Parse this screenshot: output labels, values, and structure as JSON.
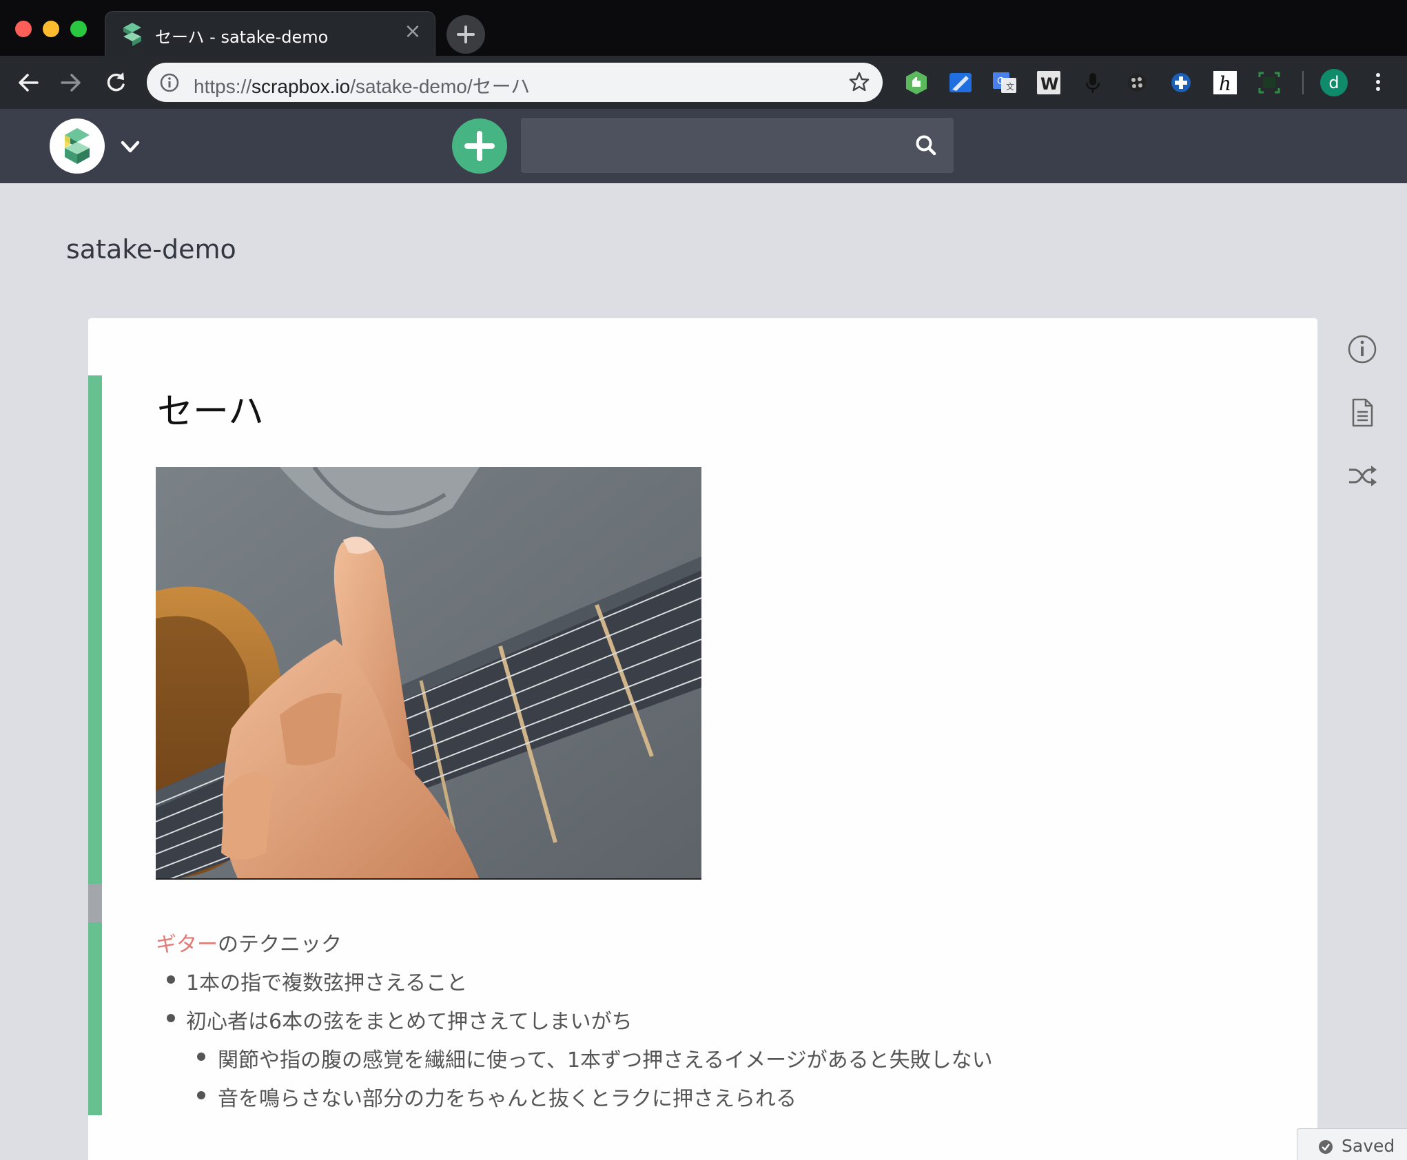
{
  "browser": {
    "tab": {
      "title": "セーハ - satake-demo",
      "close": "×"
    },
    "url": {
      "scheme": "https://",
      "host": "scrapbox.io",
      "path": "/satake-demo/セーハ"
    },
    "profile_initial": "d",
    "extensions": [
      "evernote-icon",
      "sharing-icon",
      "translate-icon",
      "w-extension-icon",
      "mic-icon",
      "bubble-icon",
      "plus-circle-icon",
      "hypothesis-icon",
      "screenshot-icon"
    ]
  },
  "header": {
    "search": {
      "placeholder": ""
    }
  },
  "project": {
    "name": "satake-demo"
  },
  "page": {
    "title": "セーハ",
    "link": "ギター",
    "intro_rest": "のテクニック",
    "items": [
      {
        "text": "1本の指で複数弦押さえること",
        "level": 1
      },
      {
        "text": "初心者は6本の弦をまとめて押さえてしまいがち",
        "level": 1
      },
      {
        "text": "関節や指の腹の感覚を繊細に使って、1本ずつ押さえるイメージがあると失敗しない",
        "level": 2
      },
      {
        "text": "音を鳴らさない部分の力をちゃんと抜くとラクに押さえられる",
        "level": 2
      }
    ]
  },
  "status": {
    "saved": "Saved"
  },
  "colors": {
    "accent": "#47b583",
    "bar": "#67c08f",
    "link": "#e27a76",
    "header": "#3a3f4b"
  }
}
